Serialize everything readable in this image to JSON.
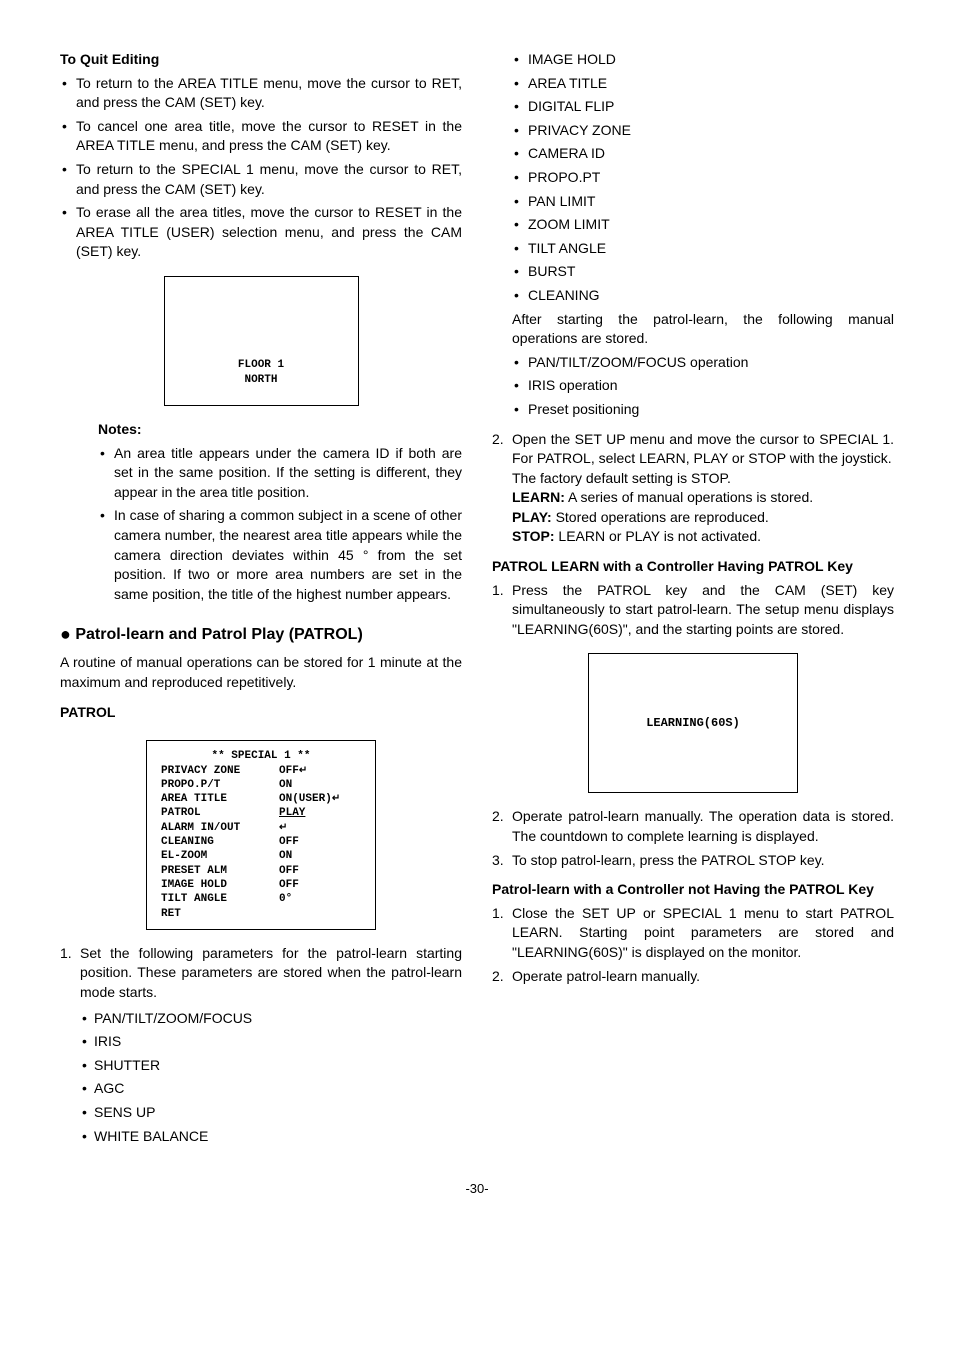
{
  "left": {
    "h_quit": "To Quit Editing",
    "quit_items": [
      "To return to the AREA TITLE menu, move the cursor to RET, and press the CAM (SET) key.",
      "To cancel one area title, move the cursor to RESET in the AREA TITLE menu, and press the CAM (SET) key.",
      "To return to the SPECIAL 1 menu, move the cursor to RET, and press the CAM (SET) key.",
      "To erase all the area titles, move the cursor to RESET in the AREA TITLE (USER) selection menu, and press the CAM (SET) key."
    ],
    "screen1_l1": "FLOOR 1",
    "screen1_l2": "NORTH",
    "notes_h": "Notes:",
    "notes_items": [
      "An area title appears under the camera ID if both are set in the same position. If the setting is different, they appear in the area title position.",
      "In case of sharing a common subject in a scene of other camera number, the nearest area title appears while the camera direction deviates within 45 ° from the set position. If two or more area numbers are set in the same position, the title of the highest number appears."
    ],
    "h_patrol_section": "Patrol-learn and Patrol Play (PATROL)",
    "patrol_intro": "A routine of manual operations can be stored for 1 minute at the maximum and reproduced repetitively.",
    "h_patrol_sub": "PATROL",
    "special_menu": {
      "title": "** SPECIAL 1 **",
      "rows": [
        {
          "lbl": "PRIVACY ZONE",
          "val": "OFF",
          "arrow": true
        },
        {
          "lbl": "PROPO.P/T",
          "val": "ON"
        },
        {
          "lbl": "AREA TITLE",
          "val": "ON(USER)",
          "arrow": true
        },
        {
          "lbl": "PATROL",
          "val": "PLAY",
          "u": true
        },
        {
          "lbl": "ALARM IN/OUT",
          "val": "",
          "arrow": true
        },
        {
          "lbl": "CLEANING",
          "val": "OFF"
        },
        {
          "lbl": "EL-ZOOM",
          "val": "ON"
        },
        {
          "lbl": "PRESET ALM",
          "val": "OFF"
        },
        {
          "lbl": "IMAGE HOLD",
          "val": "OFF"
        },
        {
          "lbl": "TILT ANGLE",
          "val": "0°"
        },
        {
          "lbl": "RET",
          "val": ""
        }
      ]
    },
    "step1_intro": "Set the following parameters for the patrol-learn starting position. These parameters are stored when the patrol-learn mode starts.",
    "step1_params": [
      "PAN/TILT/ZOOM/FOCUS",
      "IRIS",
      "SHUTTER",
      "AGC",
      "SENS UP",
      "WHITE BALANCE"
    ]
  },
  "right": {
    "params_cont": [
      "IMAGE HOLD",
      "AREA TITLE",
      "DIGITAL FLIP",
      "PRIVACY ZONE",
      "CAMERA ID",
      "PROPO.PT",
      "PAN LIMIT",
      "ZOOM LIMIT",
      "TILT ANGLE",
      "BURST",
      "CLEANING"
    ],
    "after_start": "After starting the patrol-learn, the following manual operations are stored.",
    "after_items": [
      "PAN/TILT/ZOOM/FOCUS operation",
      "IRIS operation",
      "Preset positioning"
    ],
    "step2a": "Open the SET UP menu and move the cursor to SPECIAL 1. For PATROL, select LEARN, PLAY or STOP with the joystick.",
    "step2b": "The factory default setting is STOP.",
    "learn_lbl": "LEARN:",
    "learn_txt": " A series of manual operations is stored.",
    "play_lbl": "PLAY:",
    "play_txt": " Stored operations are reproduced.",
    "stop_lbl": "STOP:",
    "stop_txt": " LEARN or PLAY is not activated.",
    "h_with_key": "PATROL LEARN with a Controller Having PATROL Key",
    "withkey_1": "Press the PATROL key and the CAM (SET) key simultaneously to start patrol-learn. The setup menu displays \"LEARNING(60S)\", and the starting points are stored.",
    "learn_screen": "LEARNING(60S)",
    "withkey_2": "Operate patrol-learn manually. The operation data is stored. The countdown to complete learning is displayed.",
    "withkey_3": "To stop patrol-learn, press the PATROL STOP key.",
    "h_without_key": "Patrol-learn with a Controller not Having the PATROL Key",
    "without_1": "Close the SET UP or SPECIAL 1 menu to start PATROL LEARN. Starting point parameters are stored and \"LEARNING(60S)\" is displayed on the monitor.",
    "without_2": "Operate patrol-learn manually."
  },
  "page_number": "-30-"
}
